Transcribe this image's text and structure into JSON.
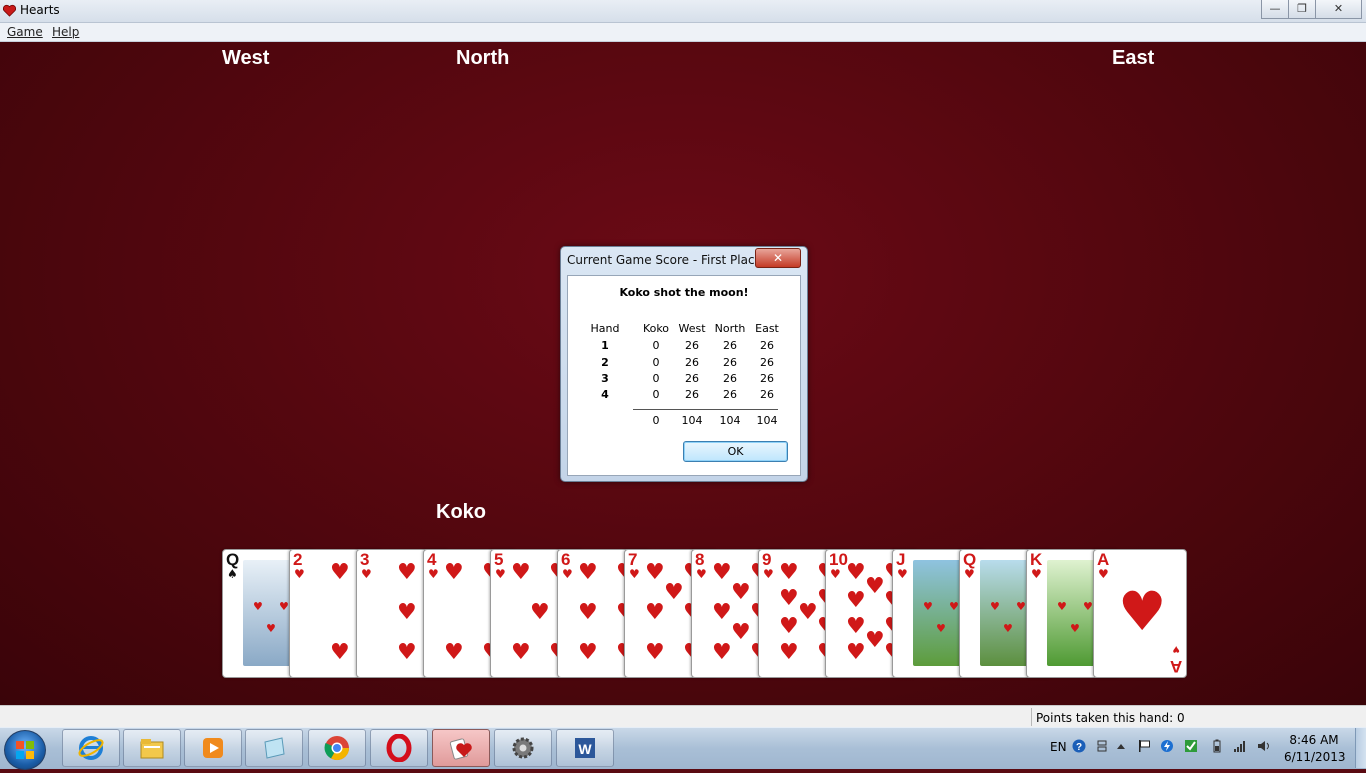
{
  "window": {
    "title": "Hearts",
    "minimize": "—",
    "maximize": "❐",
    "close": "✕"
  },
  "menu": [
    "Game",
    "Help"
  ],
  "players": {
    "west": "West",
    "north": "North",
    "east": "East",
    "south": "Koko"
  },
  "dialog": {
    "title": "Current Game Score - First Place",
    "close_label": "✕",
    "message": "Koko shot the moon!",
    "columns": [
      "Hand",
      "Koko",
      "West",
      "North",
      "East"
    ],
    "rows": [
      {
        "hand": "1",
        "koko": "0",
        "west": "26",
        "north": "26",
        "east": "26"
      },
      {
        "hand": "2",
        "koko": "0",
        "west": "26",
        "north": "26",
        "east": "26"
      },
      {
        "hand": "3",
        "koko": "0",
        "west": "26",
        "north": "26",
        "east": "26"
      },
      {
        "hand": "4",
        "koko": "0",
        "west": "26",
        "north": "26",
        "east": "26"
      }
    ],
    "totals": {
      "koko": "0",
      "west": "104",
      "north": "104",
      "east": "104"
    },
    "ok_label": "OK"
  },
  "hand": [
    {
      "rank": "Q",
      "suit": "♠",
      "color": "black",
      "face": true
    },
    {
      "rank": "2",
      "suit": "♥",
      "color": "red"
    },
    {
      "rank": "3",
      "suit": "♥",
      "color": "red"
    },
    {
      "rank": "4",
      "suit": "♥",
      "color": "red"
    },
    {
      "rank": "5",
      "suit": "♥",
      "color": "red"
    },
    {
      "rank": "6",
      "suit": "♥",
      "color": "red"
    },
    {
      "rank": "7",
      "suit": "♥",
      "color": "red"
    },
    {
      "rank": "8",
      "suit": "♥",
      "color": "red"
    },
    {
      "rank": "9",
      "suit": "♥",
      "color": "red"
    },
    {
      "rank": "10",
      "suit": "♥",
      "color": "red"
    },
    {
      "rank": "J",
      "suit": "♥",
      "color": "red",
      "face": true
    },
    {
      "rank": "Q",
      "suit": "♥",
      "color": "red",
      "face": true
    },
    {
      "rank": "K",
      "suit": "♥",
      "color": "red",
      "face": true
    },
    {
      "rank": "A",
      "suit": "♥",
      "color": "red",
      "ace": true
    }
  ],
  "status": {
    "points_text": "Points taken this hand: 0"
  },
  "taskbar": {
    "apps": [
      "internet-explorer-icon",
      "file-explorer-icon",
      "media-player-icon",
      "notepad-icon",
      "chrome-icon",
      "opera-icon",
      "hearts-icon",
      "settings-gear-icon",
      "word-icon"
    ],
    "language": "EN",
    "time": "8:46 AM",
    "date": "6/11/2013"
  },
  "colors": {
    "felt": "#5a0a12",
    "heart_red": "#d01818",
    "dialog_frame": "#c3d4e8"
  }
}
